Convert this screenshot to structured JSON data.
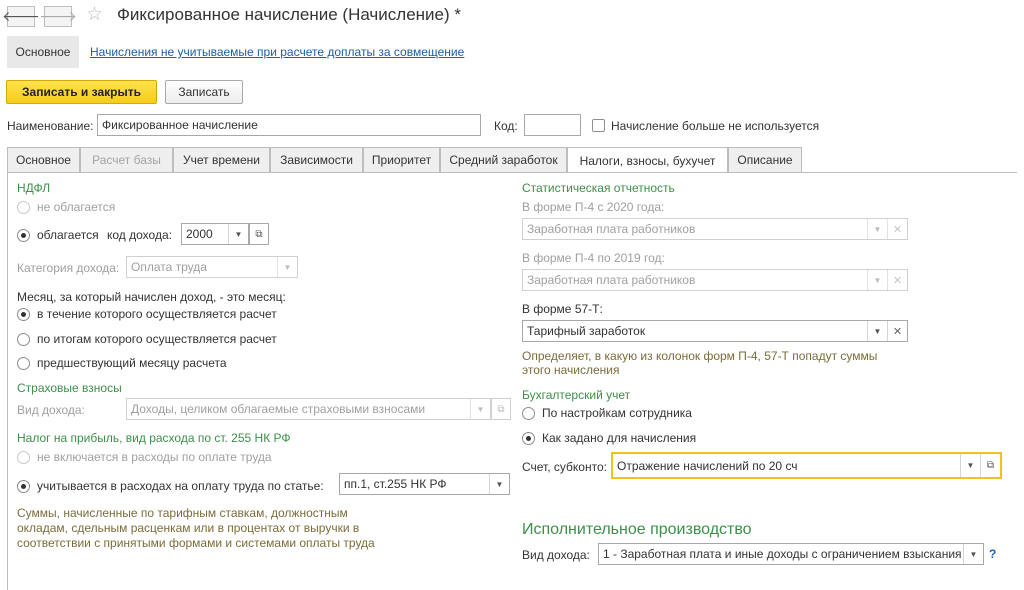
{
  "window": {
    "title": "Фиксированное начисление (Начисление) *",
    "back_icon": "arrow-left-icon",
    "forward_icon": "arrow-right-icon",
    "favorite_icon": "star-icon"
  },
  "sections": {
    "main_label": "Основное",
    "link_label": "Начисления не учитываемые при расчете доплаты за совмещение"
  },
  "toolbar": {
    "save_close_label": "Записать и закрыть",
    "save_label": "Записать"
  },
  "header": {
    "name_label": "Наименование:",
    "name_value": "Фиксированное начисление",
    "code_label": "Код:",
    "code_value": "",
    "unused_label": "Начисление больше не используется"
  },
  "tabs": [
    {
      "label": "Основное"
    },
    {
      "label": "Расчет базы"
    },
    {
      "label": "Учет времени"
    },
    {
      "label": "Зависимости"
    },
    {
      "label": "Приоритет"
    },
    {
      "label": "Средний заработок"
    },
    {
      "label": "Налоги, взносы, бухучет"
    },
    {
      "label": "Описание"
    }
  ],
  "ndfl": {
    "header": "НДФЛ",
    "not_taxed_label": "не облагается",
    "taxed_label": "облагается",
    "income_code_label": "код дохода:",
    "income_code_value": "2000",
    "category_label": "Категория дохода:",
    "category_value": "Оплата труда",
    "month_question": "Месяц, за который начислен доход, - это месяц:",
    "month_opt1": "в течение которого осуществляется расчет",
    "month_opt2": "по итогам которого осуществляется расчет",
    "month_opt3": "предшествующий месяцу расчета"
  },
  "insurance": {
    "header": "Страховые взносы",
    "income_type_label": "Вид дохода:",
    "income_type_value": "Доходы, целиком облагаемые страховыми взносами"
  },
  "profit_tax": {
    "header": "Налог на прибыль, вид расхода по ст. 255 НК РФ",
    "opt_not_included": "не включается в расходы по оплате труда",
    "opt_included": "учитывается в расходах на оплату труда по статье:",
    "article_value": "пп.1, ст.255 НК РФ",
    "hint": "Суммы, начисленные по тарифным ставкам, должностным окладам, сдельным расценкам или в процентах от выручки в соответствии с принятыми формами и системами оплаты труда"
  },
  "stats": {
    "header": "Статистическая отчетность",
    "p4_2020_label": "В форме П-4 с 2020 года:",
    "p4_2020_value": "Заработная плата работников",
    "p4_2019_label": "В форме П-4 по 2019 год:",
    "p4_2019_value": "Заработная плата работников",
    "f57_label": "В форме 57-Т:",
    "f57_value": "Тарифный заработок",
    "hint": "Определяет, в какую из колонок форм П-4, 57-Т попадут суммы этого начисления"
  },
  "accounting": {
    "header": "Бухгалтерский учет",
    "opt_employee": "По настройкам сотрудника",
    "opt_accrual": "Как задано для начисления",
    "account_label": "Счет, субконто:",
    "account_value": "Отражение начислений по 20 сч"
  },
  "enforcement": {
    "header": "Исполнительное производство",
    "income_type_label": "Вид дохода:",
    "income_type_value": "1 - Заработная плата и иные доходы с ограничением взыскания",
    "help_label": "?"
  }
}
